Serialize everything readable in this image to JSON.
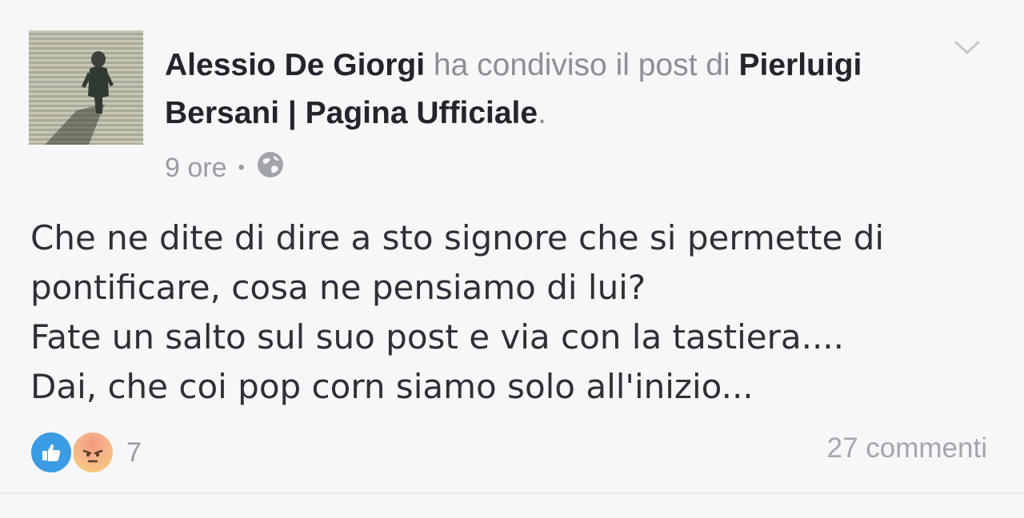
{
  "post": {
    "author": "Alessio De Giorgi",
    "action_text": " ha condiviso il post di ",
    "shared_page": "Pierluigi Bersani | Pagina Ufficiale",
    "period": ".",
    "time": "9 ore",
    "separator": "•",
    "privacy_icon": "globe-icon",
    "menu_icon": "chevron-down-icon",
    "body_lines": [
      "Che ne dite di dire a sto signore che si permette di",
      "pontificare, cosa ne pensiamo di lui?",
      "Fate un salto sul suo post e via con la tastiera....",
      "Dai, che coi pop corn siamo solo all'inizio..."
    ]
  },
  "footer": {
    "reactions": [
      {
        "type": "like",
        "icon": "thumbs-up-icon",
        "color": "#3b9be3"
      },
      {
        "type": "angry",
        "icon": "angry-face-icon",
        "color": "#f6b28a"
      }
    ],
    "reaction_count": "7",
    "comments": "27 commenti"
  }
}
